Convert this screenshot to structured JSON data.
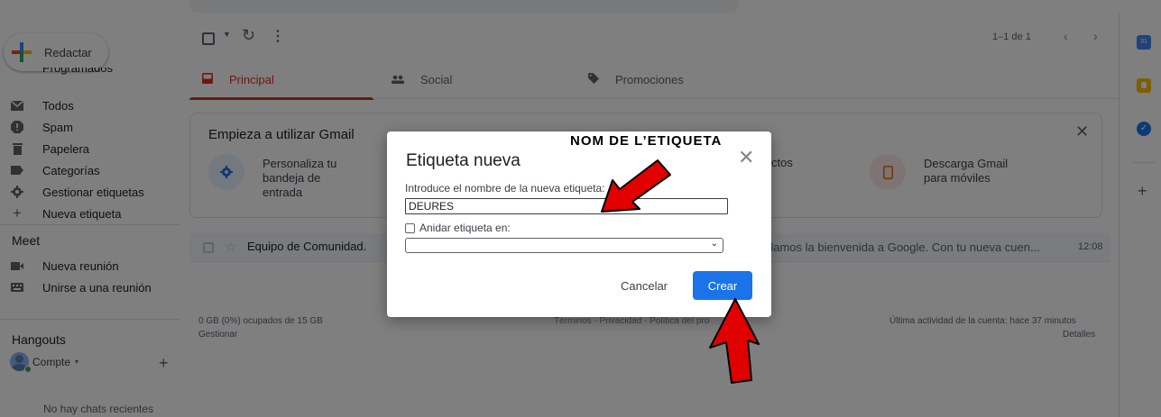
{
  "sidebar": {
    "compose_label": "Redactar",
    "cut_item_label": "Programados",
    "items": [
      {
        "label": "Todos",
        "icon": "mail-icon"
      },
      {
        "label": "Spam",
        "icon": "alert-icon"
      },
      {
        "label": "Papelera",
        "icon": "trash-icon"
      },
      {
        "label": "Categorías",
        "icon": "label-icon"
      },
      {
        "label": "Gestionar etiquetas",
        "icon": "gear-icon"
      },
      {
        "label": "Nueva etiqueta",
        "icon": "plus-icon"
      }
    ],
    "meet": {
      "heading": "Meet",
      "items": [
        {
          "label": "Nueva reunión",
          "icon": "video-icon"
        },
        {
          "label": "Unirse a una reunión",
          "icon": "keyboard-icon"
        }
      ]
    },
    "hangouts": {
      "heading": "Hangouts",
      "account_label": "Compte",
      "no_chats": "No hay chats recientes"
    }
  },
  "toolbar": {
    "count": "1–1 de 1"
  },
  "tabs": [
    {
      "label": "Principal",
      "active": true
    },
    {
      "label": "Social",
      "active": false
    },
    {
      "label": "Promociones",
      "active": false
    }
  ],
  "getting_started": {
    "title": "Empieza a utilizar Gmail",
    "items": [
      {
        "label": "Personaliza tu bandeja de entrada"
      },
      {
        "label": "ctos"
      },
      {
        "label": "Descarga Gmail para móviles"
      }
    ]
  },
  "email": {
    "sender": "Equipo de Comunidad.",
    "snippet": "damos la bienvenida a Google. Con tu nueva cuen...",
    "time": "12:08"
  },
  "footer": {
    "storage": "0 GB (0%) ocupados de 15 GB",
    "manage": "Gestionar",
    "links": "Términos · Privacidad · Política del pro",
    "activity": "Última actividad de la cuenta: hace 37 minutos",
    "details": "Detalles"
  },
  "right_rail": {
    "calendar_day": "31"
  },
  "dialog": {
    "title": "Etiqueta nueva",
    "name_label": "Introduce el nombre de la nueva etiqueta:",
    "name_value": "DEURES",
    "nest_label": "Anidar etiqueta en:",
    "cancel_label": "Cancelar",
    "create_label": "Crear"
  },
  "annotation": {
    "text": "NOM DE L’ETIQUETA"
  },
  "colors": {
    "overlay": "#000000",
    "accent_blue": "#1a73e8",
    "tab_active_red": "#d93025",
    "arrow_red": "#e00000"
  }
}
